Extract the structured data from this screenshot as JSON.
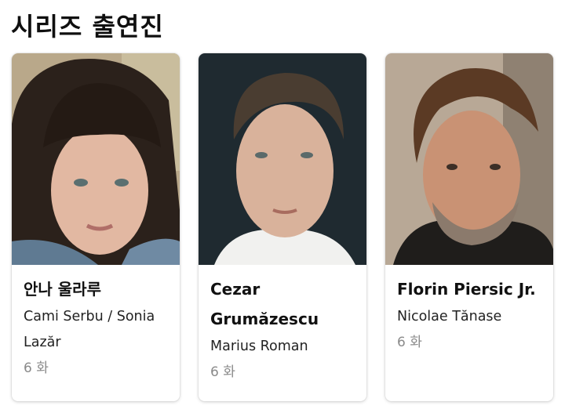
{
  "section": {
    "title": "시리즈 출연진"
  },
  "cast": [
    {
      "name": "안나 울라루",
      "role": "Cami Serbu / Sonia Lazăr",
      "episodes": "6 화"
    },
    {
      "name": "Cezar Grumăzescu",
      "role": "Marius Roman",
      "episodes": "6 화"
    },
    {
      "name": "Florin Piersic Jr.",
      "role": "Nicolae Tănase",
      "episodes": "6 화"
    }
  ]
}
